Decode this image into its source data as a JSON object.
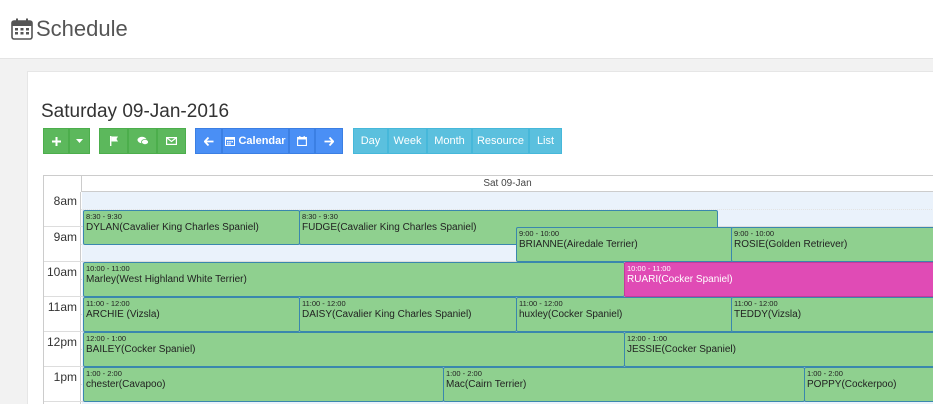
{
  "header": {
    "title": "Schedule",
    "icon": "calendar-icon"
  },
  "date_title": "Saturday 09-Jan-2016",
  "toolbar": {
    "calendar_label": "Calendar",
    "views": [
      "Day",
      "Week",
      "Month",
      "Resource",
      "List"
    ]
  },
  "calendar": {
    "day_header": "Sat 09-Jan",
    "hours": [
      "8am",
      "9am",
      "10am",
      "11am",
      "12pm",
      "1pm"
    ],
    "events": [
      {
        "time": "8:30 - 9:30",
        "name": "DYLAN(Cavalier King Charles Spaniel)"
      },
      {
        "time": "8:30 - 9:30",
        "name": "FUDGE(Cavalier King Charles Spaniel)"
      },
      {
        "time": "9:00 - 10:00",
        "name": "BRIANNE(Airedale Terrier)"
      },
      {
        "time": "9:00 - 10:00",
        "name": "ROSIE(Golden Retriever)"
      },
      {
        "time": "10:00 - 11:00",
        "name": "Marley(West Highland White Terrier)"
      },
      {
        "time": "10:00 - 11:00",
        "name": "RUARI(Cocker Spaniel)"
      },
      {
        "time": "11:00 - 12:00",
        "name": "ARCHIE (Vizsla)"
      },
      {
        "time": "11:00 - 12:00",
        "name": "DAISY(Cavalier King Charles Spaniel)"
      },
      {
        "time": "11:00 - 12:00",
        "name": "huxley(Cocker Spaniel)"
      },
      {
        "time": "11:00 - 12:00",
        "name": "TEDDY(Vizsla)"
      },
      {
        "time": "12:00 - 1:00",
        "name": "BAILEY(Cocker Spaniel)"
      },
      {
        "time": "12:00 - 1:00",
        "name": "JESSIE(Cocker Spaniel)"
      },
      {
        "time": "1:00 - 2:00",
        "name": "chester(Cavapoo)"
      },
      {
        "time": "1:00 - 2:00",
        "name": "Mac(Cairn Terrier)"
      },
      {
        "time": "1:00 - 2:00",
        "name": "POPPY(Cockerpoo)"
      }
    ]
  },
  "colors": {
    "event_green": "#8fd08f",
    "event_pink": "#e04bb5",
    "btn_green": "#5cb85c",
    "btn_blue": "#4a8ff5",
    "btn_cyan": "#5bc0de"
  }
}
